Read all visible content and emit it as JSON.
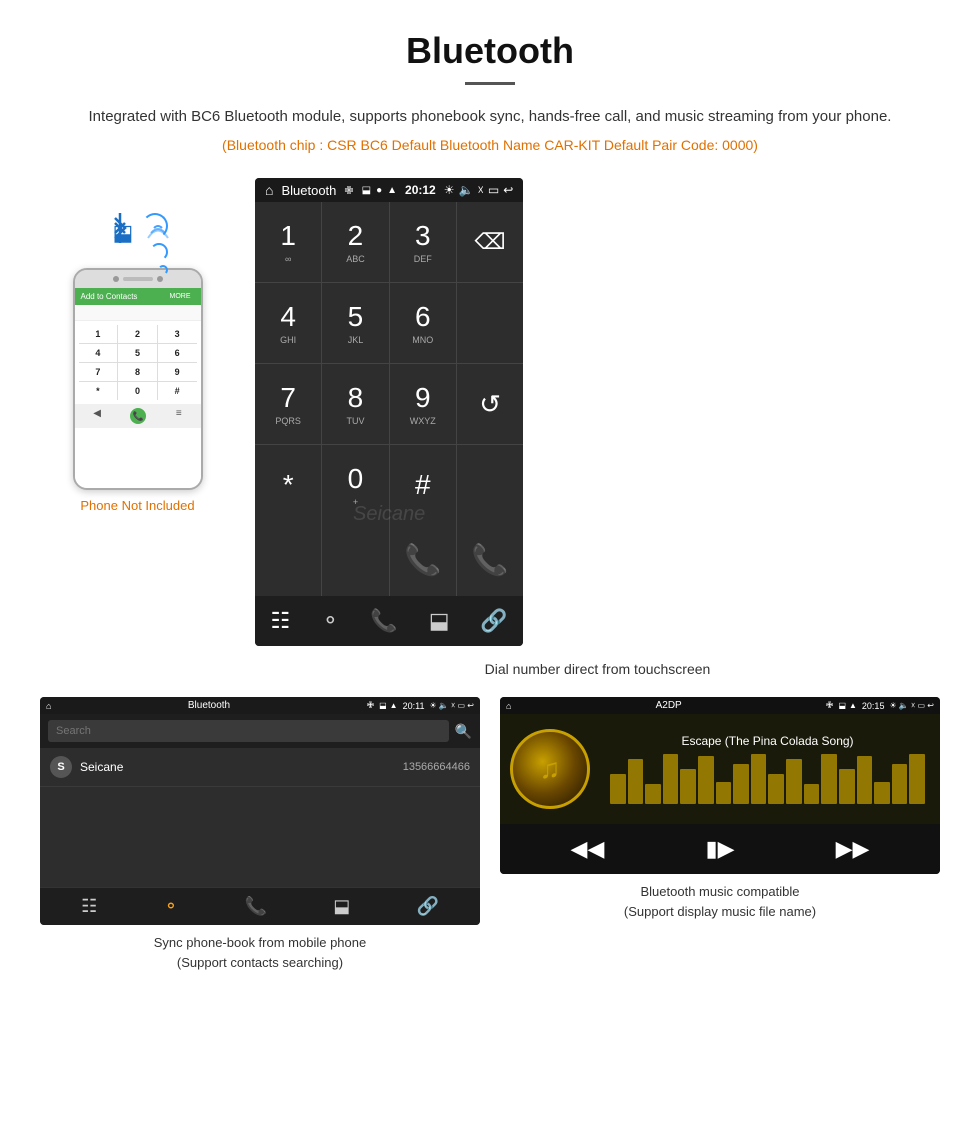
{
  "header": {
    "title": "Bluetooth",
    "divider": true,
    "description": "Integrated with BC6 Bluetooth module, supports phonebook sync, hands-free call, and music streaming from your phone.",
    "specs": "(Bluetooth chip : CSR BC6    Default Bluetooth Name CAR-KIT    Default Pair Code: 0000)"
  },
  "phone_image": {
    "not_included_label": "Phone Not Included",
    "screen_header": "Add to Contacts",
    "green_btn": "MORE",
    "keys": [
      "1",
      "2",
      "3",
      "4",
      "5",
      "6",
      "7",
      "8",
      "9",
      "*",
      "0",
      "#"
    ]
  },
  "dial_screen": {
    "status_bar": {
      "home": "⌂",
      "title": "Bluetooth",
      "usb": "⚡",
      "time": "20:12"
    },
    "keys": [
      {
        "number": "1",
        "letters": "∞"
      },
      {
        "number": "2",
        "letters": "ABC"
      },
      {
        "number": "3",
        "letters": "DEF"
      },
      {
        "number": "",
        "letters": ""
      },
      {
        "number": "4",
        "letters": "GHI"
      },
      {
        "number": "5",
        "letters": "JKL"
      },
      {
        "number": "6",
        "letters": "MNO"
      },
      {
        "number": "",
        "letters": ""
      },
      {
        "number": "7",
        "letters": "PQRS"
      },
      {
        "number": "8",
        "letters": "TUV"
      },
      {
        "number": "9",
        "letters": "WXYZ"
      },
      {
        "number": "",
        "letters": ""
      },
      {
        "number": "*",
        "letters": ""
      },
      {
        "number": "0",
        "letters": "+"
      },
      {
        "number": "#",
        "letters": ""
      },
      {
        "number": "",
        "letters": ""
      }
    ],
    "caption": "Dial number direct from touchscreen"
  },
  "phonebook_screen": {
    "status_bar": {
      "title": "Bluetooth",
      "time": "20:11"
    },
    "search_placeholder": "Search",
    "contact": {
      "letter": "S",
      "name": "Seicane",
      "number": "13566664466"
    }
  },
  "music_screen": {
    "status_bar": {
      "title": "A2DP",
      "time": "20:15"
    },
    "song_title": "Escape (The Pina Colada Song)",
    "eq_bars": [
      30,
      45,
      20,
      50,
      35,
      48,
      22,
      40,
      50,
      30,
      45,
      20,
      50,
      35,
      48,
      22,
      40,
      50
    ]
  },
  "captions": {
    "phonebook": "Sync phone-book from mobile phone\n(Support contacts searching)",
    "music": "Bluetooth music compatible\n(Support display music file name)"
  }
}
